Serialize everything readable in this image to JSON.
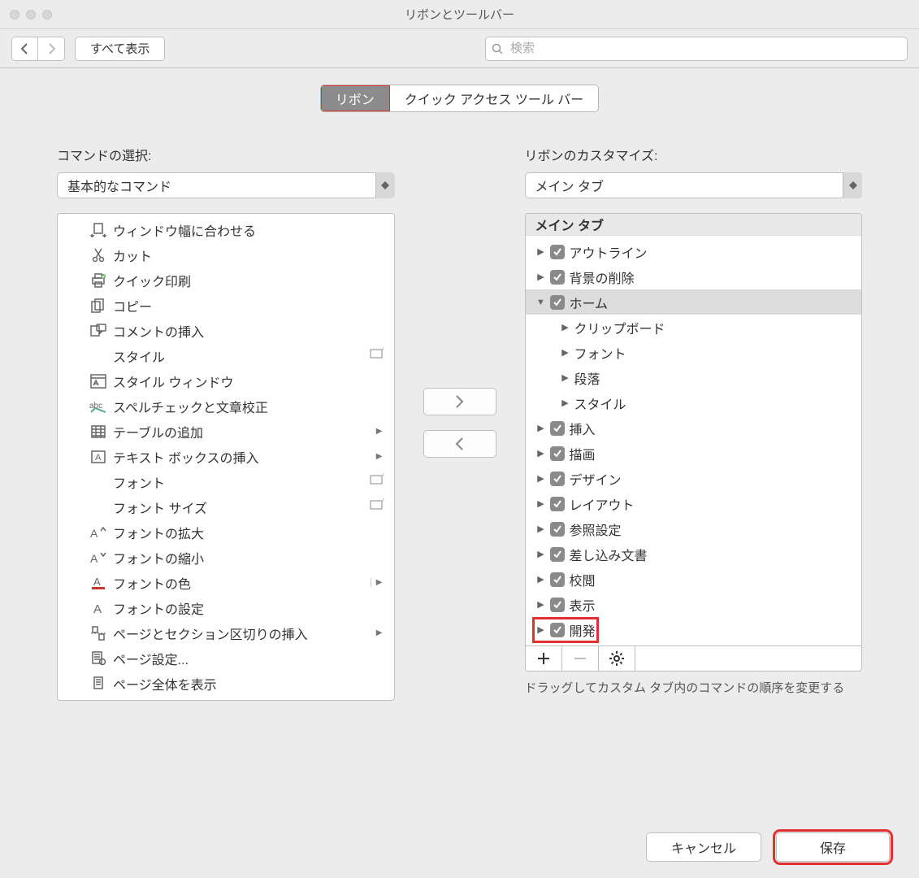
{
  "window": {
    "title": "リボンとツールバー"
  },
  "toolbar": {
    "show_all": "すべて表示",
    "search_placeholder": "検索"
  },
  "tabs": {
    "ribbon": "リボン",
    "qat": "クイック アクセス ツール バー"
  },
  "left": {
    "label": "コマンドの選択:",
    "dropdown": "基本的なコマンド",
    "items": [
      {
        "icon": "fit-width",
        "label": "ウィンドウ幅に合わせる"
      },
      {
        "icon": "cut",
        "label": "カット"
      },
      {
        "icon": "quick-print",
        "label": "クイック印刷"
      },
      {
        "icon": "copy",
        "label": "コピー"
      },
      {
        "icon": "insert-comment",
        "label": "コメントの挿入"
      },
      {
        "icon": "",
        "label": "スタイル",
        "trail": "text"
      },
      {
        "icon": "style-window",
        "label": "スタイル ウィンドウ"
      },
      {
        "icon": "spell",
        "label": "スペルチェックと文章校正"
      },
      {
        "icon": "table",
        "label": "テーブルの追加",
        "submenu": true
      },
      {
        "icon": "textbox",
        "label": "テキスト ボックスの挿入",
        "submenu": true
      },
      {
        "icon": "",
        "label": "フォント",
        "trail": "text"
      },
      {
        "icon": "",
        "label": "フォント サイズ",
        "trail": "text"
      },
      {
        "icon": "font-grow",
        "label": "フォントの拡大"
      },
      {
        "icon": "font-shrink",
        "label": "フォントの縮小"
      },
      {
        "icon": "font-color",
        "label": "フォントの色",
        "submenu": true,
        "split": true
      },
      {
        "icon": "font-settings",
        "label": "フォントの設定"
      },
      {
        "icon": "breaks",
        "label": "ページとセクション区切りの挿入",
        "submenu": true
      },
      {
        "icon": "page-setup",
        "label": "ページ設定..."
      },
      {
        "icon": "page-whole",
        "label": "ページ全体を表示"
      }
    ]
  },
  "right": {
    "label": "リボンのカスタマイズ:",
    "dropdown": "メイン タブ",
    "tree_header": "メイン タブ",
    "tree": [
      {
        "label": "アウトライン",
        "checked": true,
        "level": 1
      },
      {
        "label": "背景の削除",
        "checked": true,
        "level": 1
      },
      {
        "label": "ホーム",
        "checked": true,
        "level": 1,
        "expanded": true,
        "selected": true
      },
      {
        "label": "クリップボード",
        "level": 2
      },
      {
        "label": "フォント",
        "level": 2
      },
      {
        "label": "段落",
        "level": 2
      },
      {
        "label": "スタイル",
        "level": 2
      },
      {
        "label": "挿入",
        "checked": true,
        "level": 1
      },
      {
        "label": "描画",
        "checked": true,
        "level": 1
      },
      {
        "label": "デザイン",
        "checked": true,
        "level": 1
      },
      {
        "label": "レイアウト",
        "checked": true,
        "level": 1
      },
      {
        "label": "参照設定",
        "checked": true,
        "level": 1
      },
      {
        "label": "差し込み文書",
        "checked": true,
        "level": 1
      },
      {
        "label": "校閲",
        "checked": true,
        "level": 1
      },
      {
        "label": "表示",
        "checked": true,
        "level": 1
      },
      {
        "label": "開発",
        "checked": true,
        "level": 1,
        "highlight": true
      }
    ],
    "help": "ドラッグしてカスタム タブ内のコマンドの順序を変更する"
  },
  "footer": {
    "cancel": "キャンセル",
    "save": "保存"
  }
}
